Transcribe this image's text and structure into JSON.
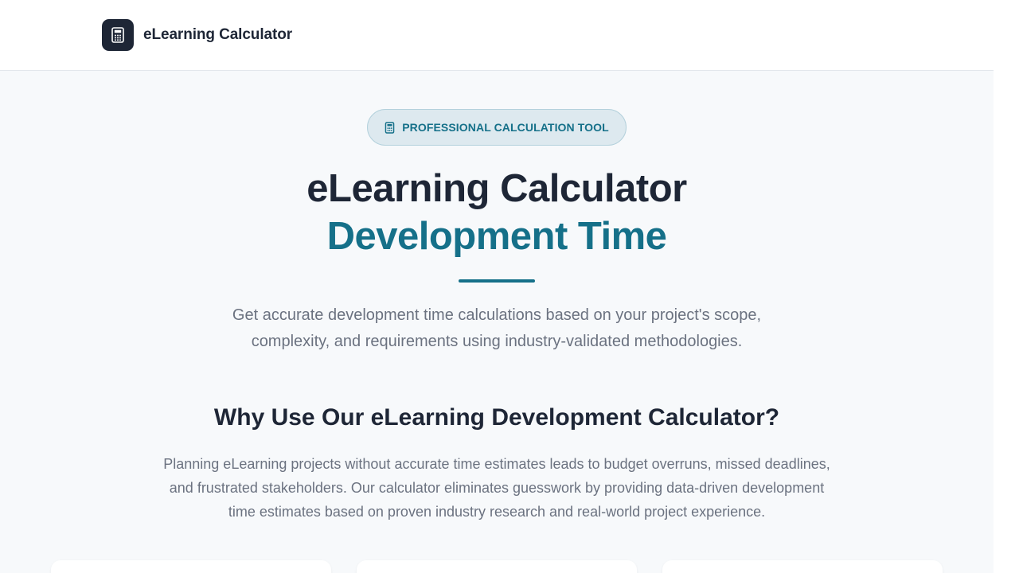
{
  "header": {
    "brand": "eLearning Calculator",
    "logo_icon": "calculator-icon"
  },
  "hero": {
    "badge_icon": "calculator-icon",
    "badge_text": "PROFESSIONAL CALCULATION TOOL",
    "title_line1": "eLearning Calculator",
    "title_line2": "Development Time",
    "lead_line1": "Get accurate development time calculations based on your project's scope,",
    "lead_line2": "complexity, and requirements using industry-validated methodologies."
  },
  "why": {
    "heading": "Why Use Our eLearning Development Calculator?",
    "paragraph_line1": "Planning eLearning projects without accurate time estimates leads to budget overruns, missed deadlines,",
    "paragraph_line2": "and frustrated stakeholders. Our calculator eliminates guesswork by providing data-driven development",
    "paragraph_line3": "time estimates based on proven industry research and real-world project experience."
  },
  "colors": {
    "brand_dark": "#1e2636",
    "accent": "#157089",
    "muted_text": "#6b7280",
    "badge_bg": "#dde9ef"
  }
}
